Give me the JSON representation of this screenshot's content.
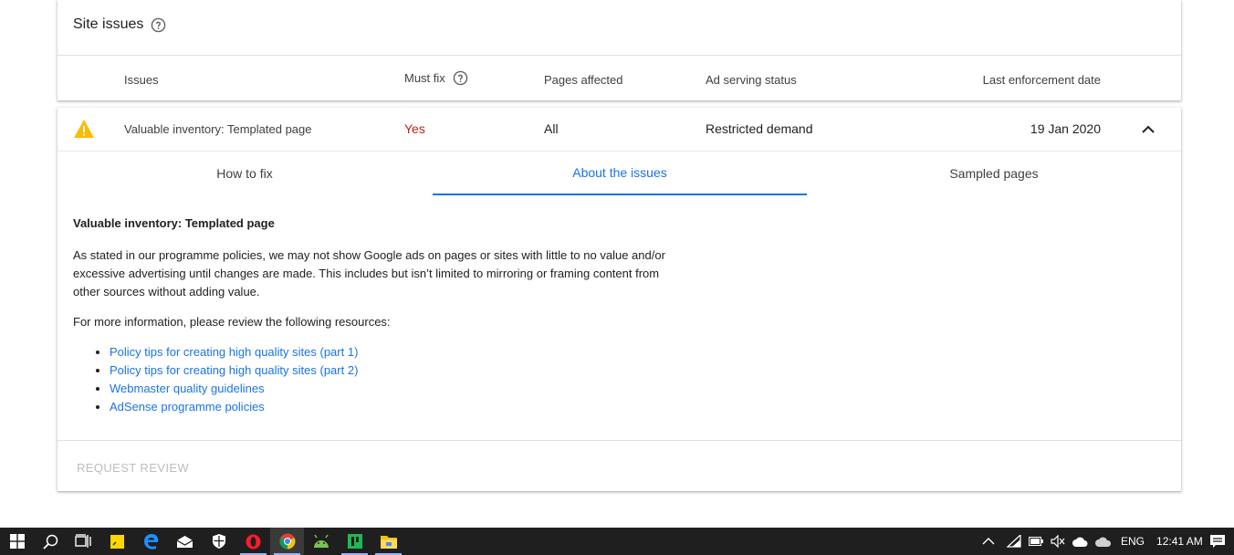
{
  "site_issues": {
    "title": "Site issues",
    "columns": {
      "issues": "Issues",
      "must_fix": "Must fix",
      "pages_affected": "Pages affected",
      "ad_serving_status": "Ad serving status",
      "last_enforcement_date": "Last enforcement date"
    }
  },
  "issue": {
    "name": "Valuable inventory: Templated page",
    "must_fix": "Yes",
    "pages_affected": "All",
    "ad_serving_status": "Restricted demand",
    "last_enforcement_date": "19 Jan 2020"
  },
  "tabs": {
    "how_to_fix": "How to fix",
    "about": "About the issues",
    "sampled": "Sampled pages"
  },
  "about": {
    "heading": "Valuable inventory: Templated page",
    "paragraph": "As stated in our programme policies, we may not show Google ads on pages or sites with little to no value and/or excessive advertising until changes are made. This includes but isn’t limited to mirroring or framing content from other sources without adding value.",
    "resources_intro": "For more information, please review the following resources:",
    "links": [
      "Policy tips for creating high quality sites (part 1)",
      "Policy tips for creating high quality sites (part 2)",
      "Webmaster quality guidelines",
      "AdSense programme policies"
    ]
  },
  "footer": {
    "request_review": "REQUEST REVIEW"
  },
  "taskbar": {
    "language": "ENG",
    "time": "12:41 AM",
    "apps": [
      "start-icon",
      "search-icon",
      "task-view-icon",
      "sticky-notes-icon",
      "edge-icon",
      "mail-icon",
      "security-icon",
      "opera-icon",
      "chrome-icon",
      "android-icon",
      "app-icon",
      "file-explorer-icon"
    ]
  },
  "colors": {
    "accent": "#1a73e8",
    "must_fix": "#b3261e",
    "warning": "#fbbc04"
  }
}
